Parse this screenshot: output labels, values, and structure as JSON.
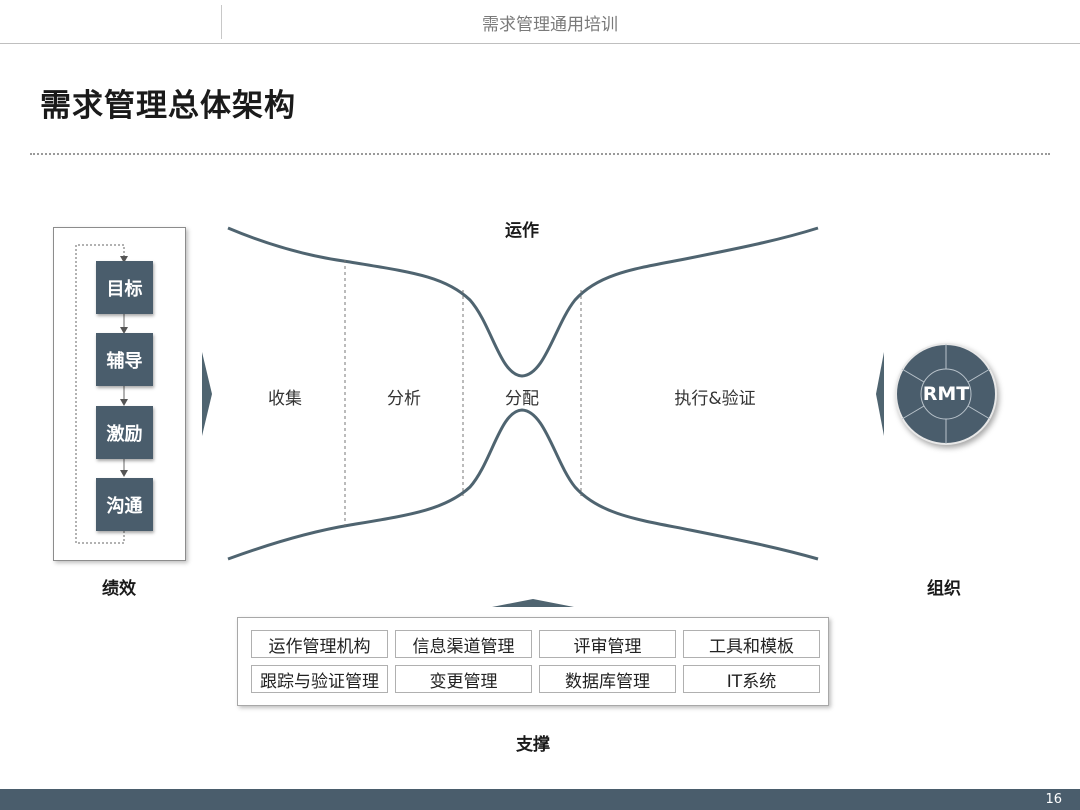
{
  "header": {
    "title": "需求管理通用培训"
  },
  "page": {
    "title": "需求管理总体架构",
    "number": "16"
  },
  "performance": {
    "label": "绩效",
    "steps": [
      "目标",
      "辅导",
      "激励",
      "沟通"
    ]
  },
  "operation": {
    "label": "运作",
    "stages": [
      "收集",
      "分析",
      "分配",
      "执行&验证"
    ]
  },
  "organization": {
    "label": "组织",
    "badge": "RMT"
  },
  "support": {
    "label": "支撑",
    "items": [
      "运作管理机构",
      "信息渠道管理",
      "评审管理",
      "工具和模板",
      "跟踪与验证管理",
      "变更管理",
      "数据库管理",
      "IT系统"
    ]
  },
  "colors": {
    "accent": "#4a5d6c",
    "curve": "#4f6470"
  }
}
